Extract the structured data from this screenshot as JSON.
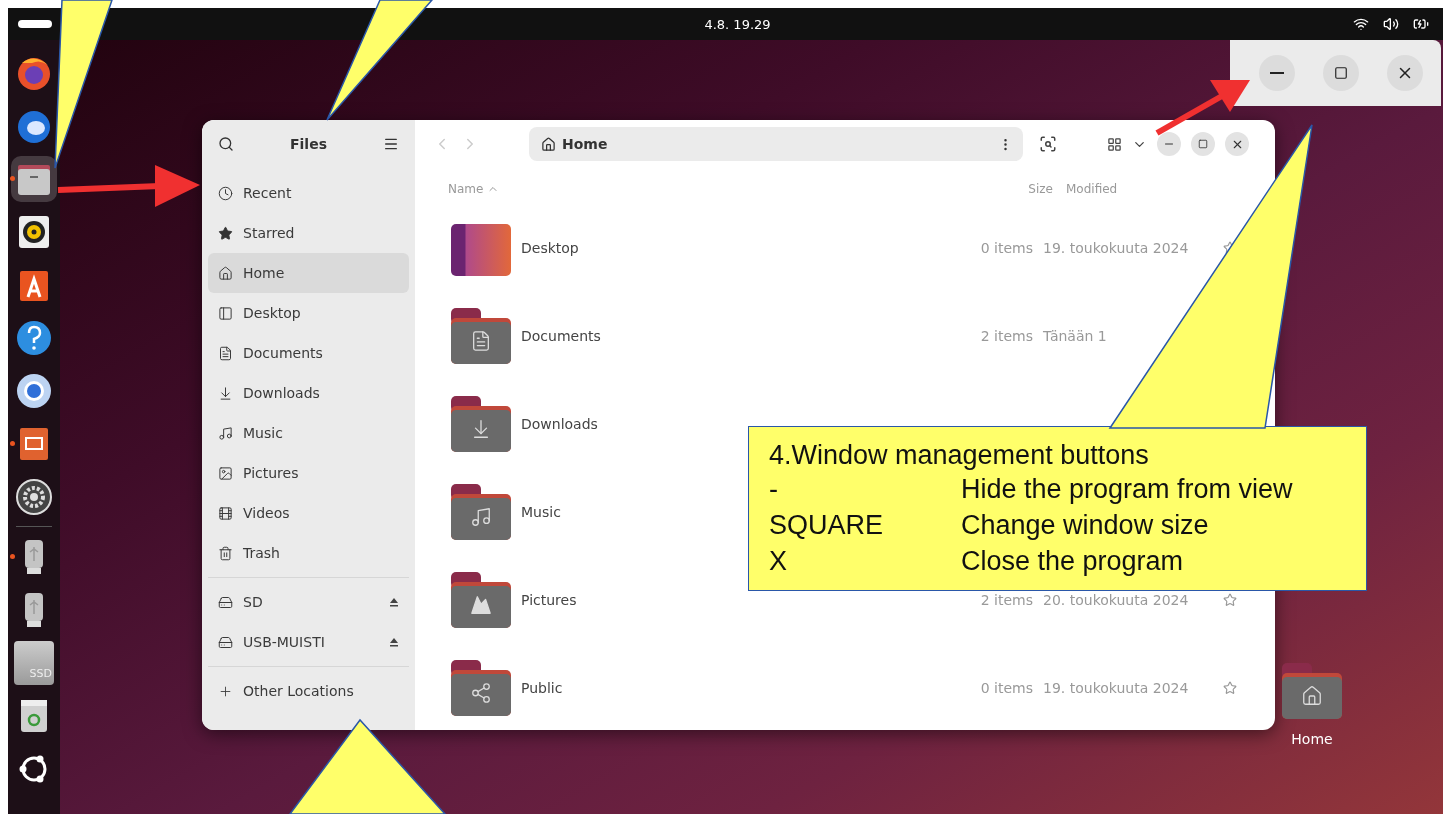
{
  "top_bar": {
    "clock": "4.8. 19.29"
  },
  "dock": {
    "apps": [
      {
        "kind": "browser",
        "running": false,
        "selected": false
      },
      {
        "kind": "mail",
        "running": false,
        "selected": false
      },
      {
        "kind": "files",
        "running": true,
        "selected": true
      },
      {
        "kind": "speaker",
        "running": false,
        "selected": false
      },
      {
        "kind": "store",
        "running": false,
        "selected": false
      },
      {
        "kind": "help",
        "running": false,
        "selected": false
      },
      {
        "kind": "globe",
        "running": false,
        "selected": false
      },
      {
        "kind": "presentation",
        "running": true,
        "selected": false
      },
      {
        "kind": "settings",
        "running": false,
        "selected": false
      }
    ],
    "devices": [
      {
        "kind": "usb",
        "running": true,
        "selected": false
      },
      {
        "kind": "usb",
        "running": false,
        "selected": false
      },
      {
        "kind": "ssd",
        "label": "SSD",
        "running": false,
        "selected": false
      },
      {
        "kind": "trash",
        "running": false,
        "selected": false
      },
      {
        "kind": "logo",
        "running": false,
        "selected": false
      }
    ]
  },
  "files_window": {
    "title": "Files",
    "places": [
      {
        "kind": "recent",
        "label": "Recent",
        "selected": false
      },
      {
        "kind": "starred",
        "label": "Starred",
        "selected": false
      },
      {
        "kind": "home",
        "label": "Home",
        "selected": true
      },
      {
        "kind": "desktop",
        "label": "Desktop",
        "selected": false
      },
      {
        "kind": "documents",
        "label": "Documents",
        "selected": false
      },
      {
        "kind": "downloads",
        "label": "Downloads",
        "selected": false
      },
      {
        "kind": "music",
        "label": "Music",
        "selected": false
      },
      {
        "kind": "pictures",
        "label": "Pictures",
        "selected": false
      },
      {
        "kind": "videos",
        "label": "Videos",
        "selected": false
      },
      {
        "kind": "trash",
        "label": "Trash",
        "selected": false
      }
    ],
    "devices": [
      {
        "label": "SD",
        "ejectable": true
      },
      {
        "label": "USB-MUISTI",
        "ejectable": true
      }
    ],
    "other_locations": "Other Locations",
    "path": "Home",
    "columns": [
      "Name",
      "Size",
      "Modified"
    ],
    "rows": [
      {
        "kind": "desktop",
        "name": "Desktop",
        "size": "0 items",
        "modified": "19. toukokuuta 2024"
      },
      {
        "kind": "documents",
        "name": "Documents",
        "size": "2 items",
        "modified": "Tänään 1"
      },
      {
        "kind": "downloads",
        "name": "Downloads"
      },
      {
        "kind": "music",
        "name": "Music"
      },
      {
        "kind": "pictures",
        "name": "Pictures",
        "size": "2 items",
        "modified": "20. toukokuuta 2024"
      },
      {
        "kind": "public",
        "name": "Public",
        "size": "0 items",
        "modified": "19. toukokuuta 2024"
      }
    ]
  },
  "desktop_icons": [
    {
      "label": "Home"
    }
  ],
  "callout": {
    "title": "4.Window management buttons",
    "rows": [
      {
        "key": "-",
        "text": "Hide the program from view"
      },
      {
        "key": "SQUARE",
        "text": "Change window size"
      },
      {
        "key": "X",
        "text": "Close the program"
      }
    ]
  }
}
